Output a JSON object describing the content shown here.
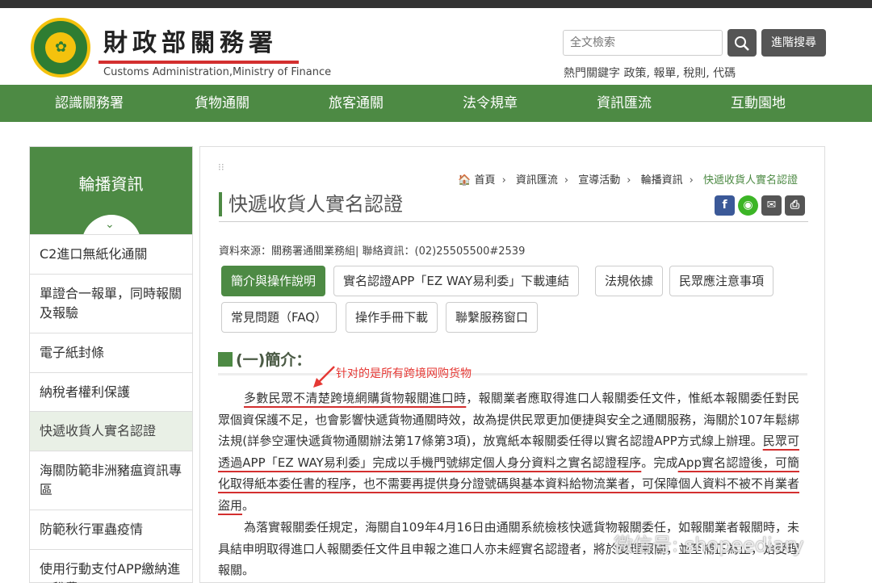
{
  "header": {
    "title": "財政部關務署",
    "subtitle": "Customs Administration,Ministry of Finance",
    "search_placeholder": "全文檢索",
    "advanced_search": "進階搜尋",
    "hot_keywords": "熱門關鍵字 政策, 報單, 稅則, 代碼"
  },
  "nav": [
    "認識關務署",
    "貨物通關",
    "旅客通關",
    "法令規章",
    "資訊匯流",
    "互動園地"
  ],
  "sidebar": {
    "title": "輪播資訊",
    "items": [
      "C2進口無紙化通關",
      "單證合一報單，同時報關及報驗",
      "電子紙封條",
      "納稅者權利保護",
      "快遞收貨人實名認證",
      "海關防範非洲豬瘟資訊專區",
      "防範秋行軍蟲疫情",
      "使用行動支付APP繳納進口稅費"
    ]
  },
  "breadcrumb": [
    "首頁",
    "資訊匯流",
    "宣導活動",
    "輪播資訊",
    "快遞收貨人實名認證"
  ],
  "page": {
    "title": "快遞收貨人實名認證",
    "source": "資料來源：關務署通關業務組| 聯絡資訊：(02)25505500#2539",
    "tabs": [
      "簡介與操作說明",
      "實名認證APP「EZ WAY易利委」下載連結",
      "法規依據",
      "民眾應注意事項",
      "常見問題（FAQ）",
      "操作手冊下載",
      "聯繫服務窗口"
    ],
    "section_title": "(一)簡介：",
    "annotation": "针对的是所有跨境网购货物",
    "para1": {
      "u1": "多數民眾不清楚跨境網購貨物報關進口時",
      "t1": "，報關業者應取得進口人報關委任文件，惟紙本報關委任對民眾個資保護不足，也會影響快遞貨物通關時效，故為提供民眾更加便捷與安全之通關服務，海關於107年鬆綁法規(詳參空運快遞貨物通關辦法第17條第3項)，放寬紙本報關委任得以實名認證APP方式線上辦理。",
      "u2": "民眾可透過APP「EZ WAY易利委」完成以手機門號綁定個人身分資料之實名認證程序",
      "t2": "。完成",
      "u3": "App實名認證後，可簡化取得紙本委任書的程序，也不需要再提供身分證號碼與基本資料給物流業者，可保障個人資料不被不肖業者盜用",
      "t3": "。"
    },
    "para2": "為落實報關委任規定，海關自109年4月16日由通關系統檢核快遞貨物報關委任，如報關業者報關時，未具結申明取得進口人報關委任文件且申報之進口人亦未經實名認證者，將於受理報關，並至補正為止，始受理報關。",
    "watermark": "微信号: shopeediary"
  },
  "colors": {
    "brand_green": "#4d8a44",
    "underline_red": "#d32f2f"
  }
}
